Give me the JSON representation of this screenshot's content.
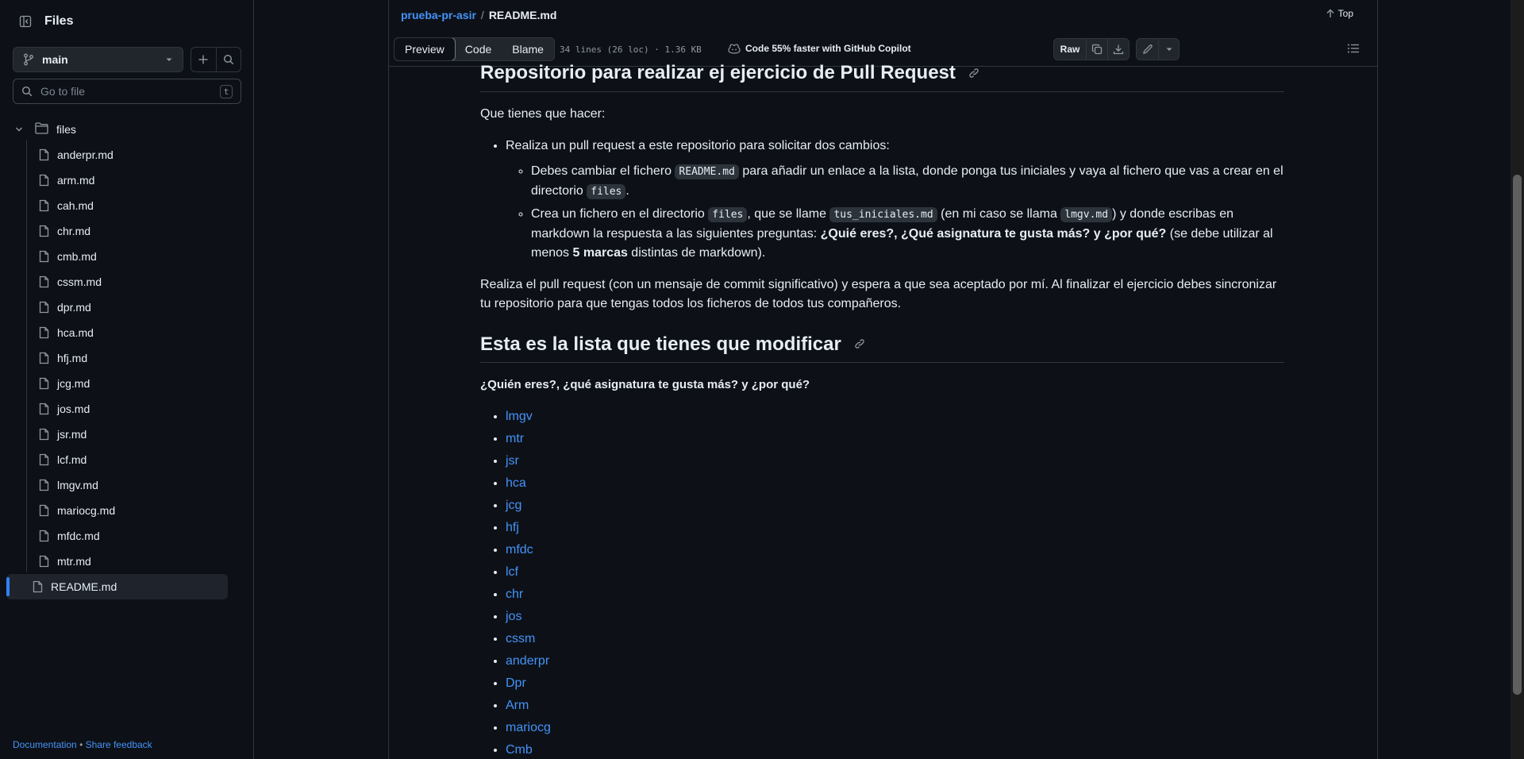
{
  "sidebar": {
    "title": "Files",
    "branch": "main",
    "search_placeholder": "Go to file",
    "search_shortcut": "t",
    "folder": "files",
    "files": [
      "anderpr.md",
      "arm.md",
      "cah.md",
      "chr.md",
      "cmb.md",
      "cssm.md",
      "dpr.md",
      "hca.md",
      "hfj.md",
      "jcg.md",
      "jos.md",
      "jsr.md",
      "lcf.md",
      "lmgv.md",
      "mariocg.md",
      "mfdc.md",
      "mtr.md"
    ],
    "selected_file": "README.md",
    "footer": {
      "docs": "Documentation",
      "bullet": "•",
      "feedback": "Share feedback"
    }
  },
  "header": {
    "repo": "prueba-pr-asir",
    "separator": "/",
    "file": "README.md",
    "top_label": "Top"
  },
  "toolbar": {
    "tabs": [
      "Preview",
      "Code",
      "Blame"
    ],
    "active_tab": "Preview",
    "meta": "34 lines (26 loc) · 1.36 KB",
    "copilot": "Code 55% faster with GitHub Copilot",
    "raw_label": "Raw"
  },
  "readme": {
    "h1": "Repositorio para realizar ej ejercicio de Pull Request",
    "intro": "Que tienes que hacer:",
    "bullet1": "Realiza un pull request a este repositorio para solicitar dos cambios:",
    "sub1": {
      "a": "Debes cambiar el fichero ",
      "code1": "README.md",
      "b": " para añadir un enlace a la lista, donde ponga tus iniciales y vaya al fichero que vas a crear en el directorio ",
      "code2": "files",
      "c": "."
    },
    "sub2": {
      "a": "Crea un fichero en el directorio ",
      "code1": "files",
      "b": ", que se llame ",
      "code2": "tus_iniciales.md",
      "c": " (en mi caso se llama ",
      "code3": "lmgv.md",
      "d": ") y donde escribas en markdown la respuesta a las siguientes preguntas: ",
      "bold1": "¿Quié eres?, ¿Qué asignatura te gusta más? y ¿por qué?",
      "e": " (se debe utilizar al menos ",
      "bold2": "5 marcas",
      "f": " distintas de markdown)."
    },
    "para2": "Realiza el pull request (con un mensaje de commit significativo) y espera a que sea aceptado por mí. Al finalizar el ejercicio debes sincronizar tu repositorio para que tengas todos los ficheros de todos tus compañeros.",
    "h2": "Esta es la lista que tienes que modificar",
    "question": "¿Quién eres?, ¿qué asignatura te gusta más? y ¿por qué?",
    "links": [
      "lmgv",
      "mtr",
      "jsr",
      "hca",
      "jcg",
      "hfj",
      "mfdc",
      "lcf",
      "chr",
      "jos",
      "cssm",
      "anderpr",
      "Dpr",
      "Arm",
      "mariocg",
      "Cmb"
    ]
  },
  "colors": {
    "link": "#4493f8",
    "bg": "#0d1117",
    "border": "#30363d"
  }
}
